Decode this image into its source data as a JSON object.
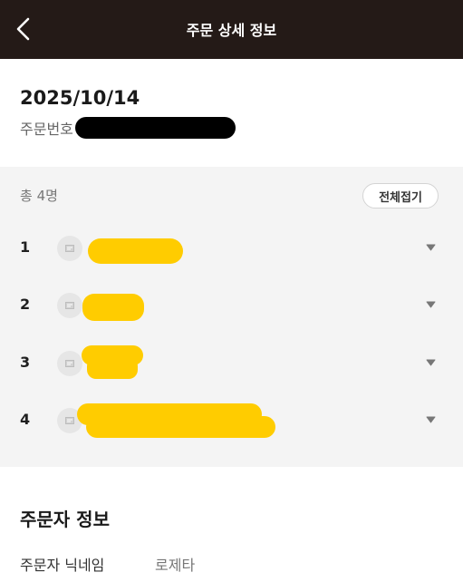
{
  "header": {
    "title": "주문 상세 정보",
    "back_icon": "chevron-left-icon",
    "background_color": "#241a17"
  },
  "order": {
    "date": "2025/10/14",
    "number_label": "주문번호"
  },
  "members": {
    "total_label": "총 4명",
    "collapse_all_label": "전체접기",
    "items": [
      {
        "index": "1"
      },
      {
        "index": "2"
      },
      {
        "index": "3"
      },
      {
        "index": "4"
      }
    ]
  },
  "orderer": {
    "section_title": "주문자 정보",
    "nickname_label": "주문자 닉네임",
    "nickname_value": "로제타"
  },
  "colors": {
    "redaction_yellow": "#ffcc00",
    "redaction_black": "#000000",
    "section_gray": "#f4f4f4"
  }
}
